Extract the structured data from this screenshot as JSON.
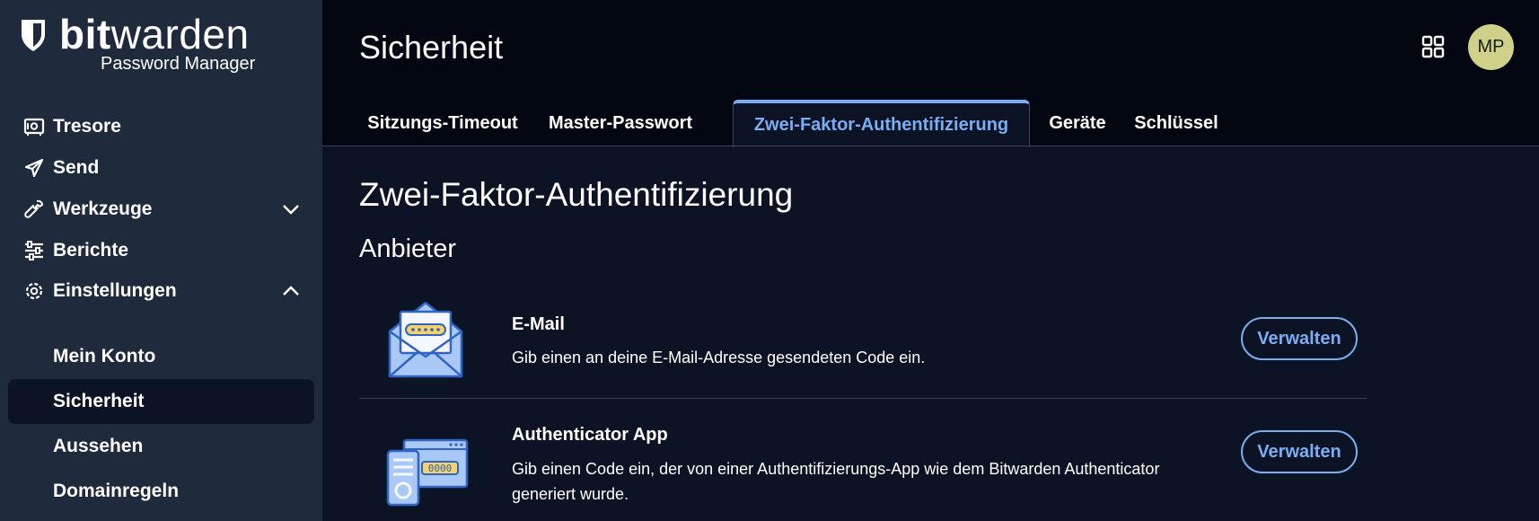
{
  "brand": {
    "word_bold": "bit",
    "word_light": "warden",
    "subtitle": "Password Manager"
  },
  "sidebar": {
    "items": [
      {
        "label": "Tresore",
        "icon": "vault-icon"
      },
      {
        "label": "Send",
        "icon": "send-icon"
      },
      {
        "label": "Werkzeuge",
        "icon": "wrench-icon",
        "chevron": "chevron-down-icon"
      },
      {
        "label": "Berichte",
        "icon": "sliders-icon"
      },
      {
        "label": "Einstellungen",
        "icon": "gear-icon",
        "chevron": "chevron-up-icon"
      }
    ],
    "subitems": [
      {
        "label": "Mein Konto"
      },
      {
        "label": "Sicherheit",
        "active": true
      },
      {
        "label": "Aussehen"
      },
      {
        "label": "Domainregeln"
      }
    ]
  },
  "header": {
    "title": "Sicherheit",
    "avatar_initials": "MP",
    "tabs": [
      {
        "label": "Sitzungs-Timeout"
      },
      {
        "label": "Master-Passwort"
      },
      {
        "label": "Zwei-Faktor-Authentifizierung",
        "active": true
      },
      {
        "label": "Geräte"
      },
      {
        "label": "Schlüssel"
      }
    ]
  },
  "main": {
    "heading": "Zwei-Faktor-Authentifizierung",
    "subheading": "Anbieter",
    "providers": [
      {
        "name": "E-Mail",
        "description": "Gib einen an deine E-Mail-Adresse gesendeten Code ein.",
        "button": "Verwalten",
        "icon": "email-envelope-icon"
      },
      {
        "name": "Authenticator App",
        "description": "Gib einen Code ein, der von einer Authentifizierungs-App wie dem Bitwarden Authenticator generiert wurde.",
        "button": "Verwalten",
        "icon": "authenticator-app-icon"
      }
    ]
  },
  "colors": {
    "accent": "#79aef5",
    "sidebar_bg": "#1f2a3c",
    "main_bg": "#0c1324",
    "header_bg": "#030711",
    "avatar_bg": "#cfd18a"
  }
}
